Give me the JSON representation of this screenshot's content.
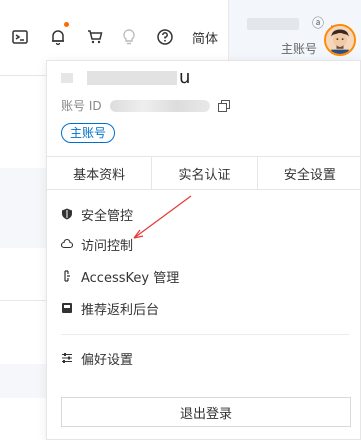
{
  "topbar": {
    "icons": [
      "terminal-icon",
      "bell-icon",
      "cart-icon",
      "lightbulb-icon",
      "help-icon"
    ],
    "lang_label": "简体",
    "account_name_tail": "ⓐ ..",
    "account_role": "主账号"
  },
  "panel": {
    "user_name": "u",
    "account_id_label": "账号 ID",
    "role_tag": "主账号",
    "tabs": [
      {
        "label": "基本资料"
      },
      {
        "label": "实名认证"
      },
      {
        "label": "安全设置"
      }
    ],
    "menu": [
      {
        "label": "安全管控",
        "icon": "shield-icon"
      },
      {
        "label": "访问控制",
        "icon": "cloud-icon"
      },
      {
        "label": "AccessKey 管理",
        "icon": "key-icon"
      },
      {
        "label": "推荐返利后台",
        "icon": "gift-icon"
      }
    ],
    "preferences": {
      "label": "偏好设置",
      "icon": "sliders-icon"
    },
    "logout_label": "退出登录"
  },
  "colors": {
    "accent": "#0070cc",
    "notify": "#ff6a00",
    "avatar_ring": "#ff8a00",
    "annotation": "#e53935"
  }
}
